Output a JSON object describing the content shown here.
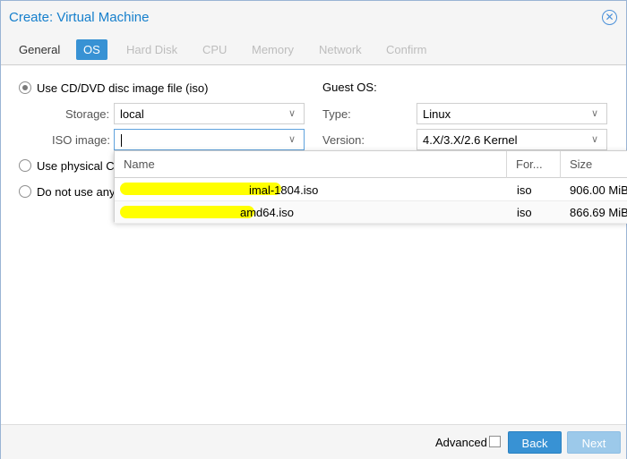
{
  "window": {
    "title": "Create: Virtual Machine"
  },
  "tabs": [
    {
      "label": "General",
      "state": "enabled"
    },
    {
      "label": "OS",
      "state": "active"
    },
    {
      "label": "Hard Disk",
      "state": "disabled"
    },
    {
      "label": "CPU",
      "state": "disabled"
    },
    {
      "label": "Memory",
      "state": "disabled"
    },
    {
      "label": "Network",
      "state": "disabled"
    },
    {
      "label": "Confirm",
      "state": "disabled"
    }
  ],
  "media": {
    "iso_option": "Use CD/DVD disc image file (iso)",
    "physical_option": "Use physical C",
    "none_option": "Do not use any",
    "storage_label": "Storage:",
    "storage_value": "local",
    "iso_label": "ISO image:",
    "iso_value": ""
  },
  "guest_os": {
    "heading": "Guest OS:",
    "type_label": "Type:",
    "type_value": "Linux",
    "version_label": "Version:",
    "version_value": "4.X/3.X/2.6 Kernel"
  },
  "iso_dropdown": {
    "columns": [
      "Name",
      "For...",
      "Size"
    ],
    "rows": [
      {
        "name_visible": "imal-1804.iso",
        "format": "iso",
        "size": "906.00 MiB"
      },
      {
        "name_visible": "amd64.iso",
        "format": "iso",
        "size": "866.69 MiB"
      }
    ]
  },
  "footer": {
    "advanced_label": "Advanced",
    "back_label": "Back",
    "next_label": "Next"
  },
  "colors": {
    "accent": "#3892d4",
    "title": "#157fcc",
    "redaction": "#ffff00"
  }
}
